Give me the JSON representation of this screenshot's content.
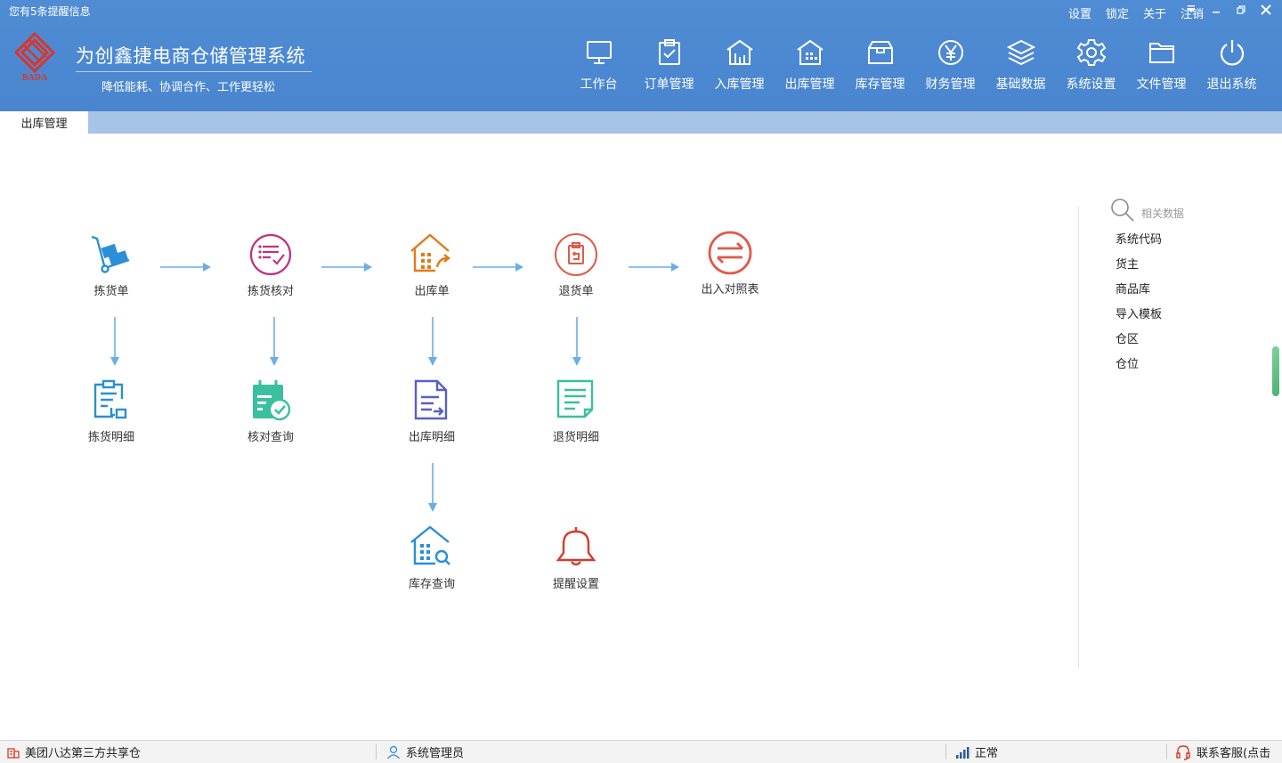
{
  "header": {
    "notice": "您有5条提醒信息",
    "app_title": "为创鑫捷电商仓储管理系统",
    "slogan": "降低能耗、协调合作、工作更轻松",
    "logo_text": "BADA",
    "top_links": [
      "设置",
      "锁定",
      "关于",
      "注销"
    ],
    "nav": [
      {
        "label": "工作台",
        "icon": "monitor-icon"
      },
      {
        "label": "订单管理",
        "icon": "clipboard-check-icon"
      },
      {
        "label": "入库管理",
        "icon": "warehouse-in-icon"
      },
      {
        "label": "出库管理",
        "icon": "warehouse-out-icon"
      },
      {
        "label": "库存管理",
        "icon": "box-icon"
      },
      {
        "label": "财务管理",
        "icon": "yen-icon"
      },
      {
        "label": "基础数据",
        "icon": "layers-icon"
      },
      {
        "label": "系统设置",
        "icon": "gear-icon"
      },
      {
        "label": "文件管理",
        "icon": "folder-icon"
      },
      {
        "label": "退出系统",
        "icon": "power-icon"
      }
    ]
  },
  "tabs": {
    "active": "出库管理"
  },
  "flow": {
    "nodes": [
      {
        "id": "picking",
        "label": "拣货单",
        "icon": "hand-truck-icon",
        "color": "#2a8fd6"
      },
      {
        "id": "pick-check",
        "label": "拣货核对",
        "icon": "list-check-icon",
        "color": "#c2307f"
      },
      {
        "id": "outbound",
        "label": "出库单",
        "icon": "house-export-icon",
        "color": "#e07b1a"
      },
      {
        "id": "return",
        "label": "退货单",
        "icon": "return-clipboard-icon",
        "color": "#e05a4a"
      },
      {
        "id": "io-compare",
        "label": "出入对照表",
        "icon": "swap-arrows-icon",
        "color": "#e05a4a"
      },
      {
        "id": "picking-detail",
        "label": "拣货明细",
        "icon": "clipboard-detail-icon",
        "color": "#2a8fd6"
      },
      {
        "id": "check-query",
        "label": "核对查询",
        "icon": "calendar-check-icon",
        "color": "#3bbf9f"
      },
      {
        "id": "outbound-detail",
        "label": "出库明细",
        "icon": "document-arrow-icon",
        "color": "#5a5fc7"
      },
      {
        "id": "return-detail",
        "label": "退货明细",
        "icon": "document-lines-icon",
        "color": "#3bbf9f"
      },
      {
        "id": "stock-query",
        "label": "库存查询",
        "icon": "house-search-icon",
        "color": "#2a8fd6"
      },
      {
        "id": "reminder",
        "label": "提醒设置",
        "icon": "bell-icon",
        "color": "#d63a2a"
      }
    ],
    "arrow_color": "#6aaee8"
  },
  "side": {
    "search_label": "相关数据",
    "items": [
      "系统代码",
      "货主",
      "商品库",
      "导入模板",
      "仓区",
      "仓位"
    ]
  },
  "status": {
    "warehouse": "美团八达第三方共享仓",
    "user": "系统管理员",
    "signal": "正常",
    "support": "联系客服(点击"
  },
  "colors": {
    "header_bg": "#4a86cf",
    "tab_bar": "#a7c3e6"
  }
}
